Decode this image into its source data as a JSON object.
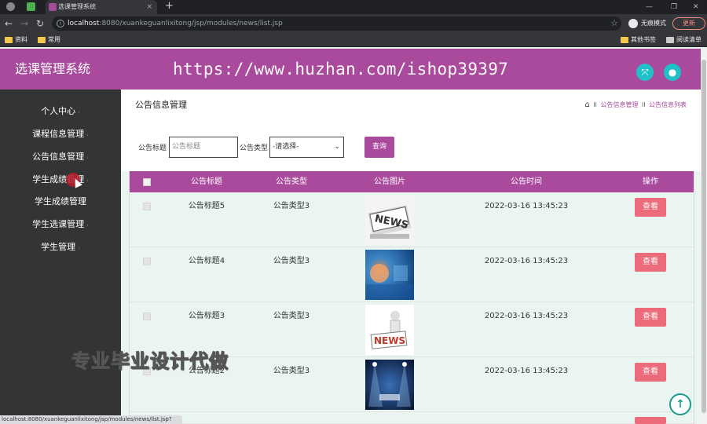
{
  "browser": {
    "tab_title": "选课管理系统",
    "tab_close": "×",
    "new_tab": "+",
    "url_host": "localhost",
    "url_path": ":8080/xuankeguanlixitong/jsp/modules/news/list.jsp",
    "incognito_label": "无痕模式",
    "update_label": "更新",
    "bookmarks": [
      "资料",
      "常用"
    ],
    "other_bookmarks": "其他书签",
    "reading_list": "阅读清单",
    "status_url": "localhost:8080/xuankeguanlixitong/jsp/modules/news/list.jsp?"
  },
  "app": {
    "title": "选课管理系统",
    "watermark": "https://www.huzhan.com/ishop39397",
    "overlay_ad": "专业毕业设计代做"
  },
  "sidebar": {
    "items": [
      {
        "label": "个人中心"
      },
      {
        "label": "课程信息管理"
      },
      {
        "label": "公告信息管理"
      },
      {
        "label": "学生成绩管理"
      },
      {
        "label": "学生成绩管理"
      },
      {
        "label": "学生选课管理"
      },
      {
        "label": "学生管理"
      }
    ]
  },
  "page": {
    "heading": "公告信息管理",
    "breadcrumb": [
      "公告信息管理",
      "公告信息列表"
    ],
    "breadcrumb_sep": "ll"
  },
  "filter": {
    "title_label": "公告标题",
    "title_placeholder": "公告标题",
    "type_label": "公告类型",
    "type_selected": "-请选择-",
    "query_button": "查询"
  },
  "table": {
    "headers": [
      "公告标题",
      "公告类型",
      "公告图片",
      "公告时间",
      "操作"
    ],
    "view_label": "查看",
    "rows": [
      {
        "title": "公告标题5",
        "type": "公告类型3",
        "time": "2022-03-16 13:45:23",
        "image": "news-paper"
      },
      {
        "title": "公告标题4",
        "type": "公告类型3",
        "time": "2022-03-16 13:45:23",
        "image": "blue-abstract"
      },
      {
        "title": "公告标题3",
        "type": "公告类型3",
        "time": "2022-03-16 13:45:23",
        "image": "news-figure"
      },
      {
        "title": "公告标题2",
        "type": "公告类型3",
        "time": "2022-03-16 13:45:23",
        "image": "stage-lights"
      }
    ]
  },
  "colors": {
    "brand": "#a94a9c",
    "sidebar": "#333436",
    "accent": "#1fc0c7",
    "view_button": "#ec6b7b"
  }
}
